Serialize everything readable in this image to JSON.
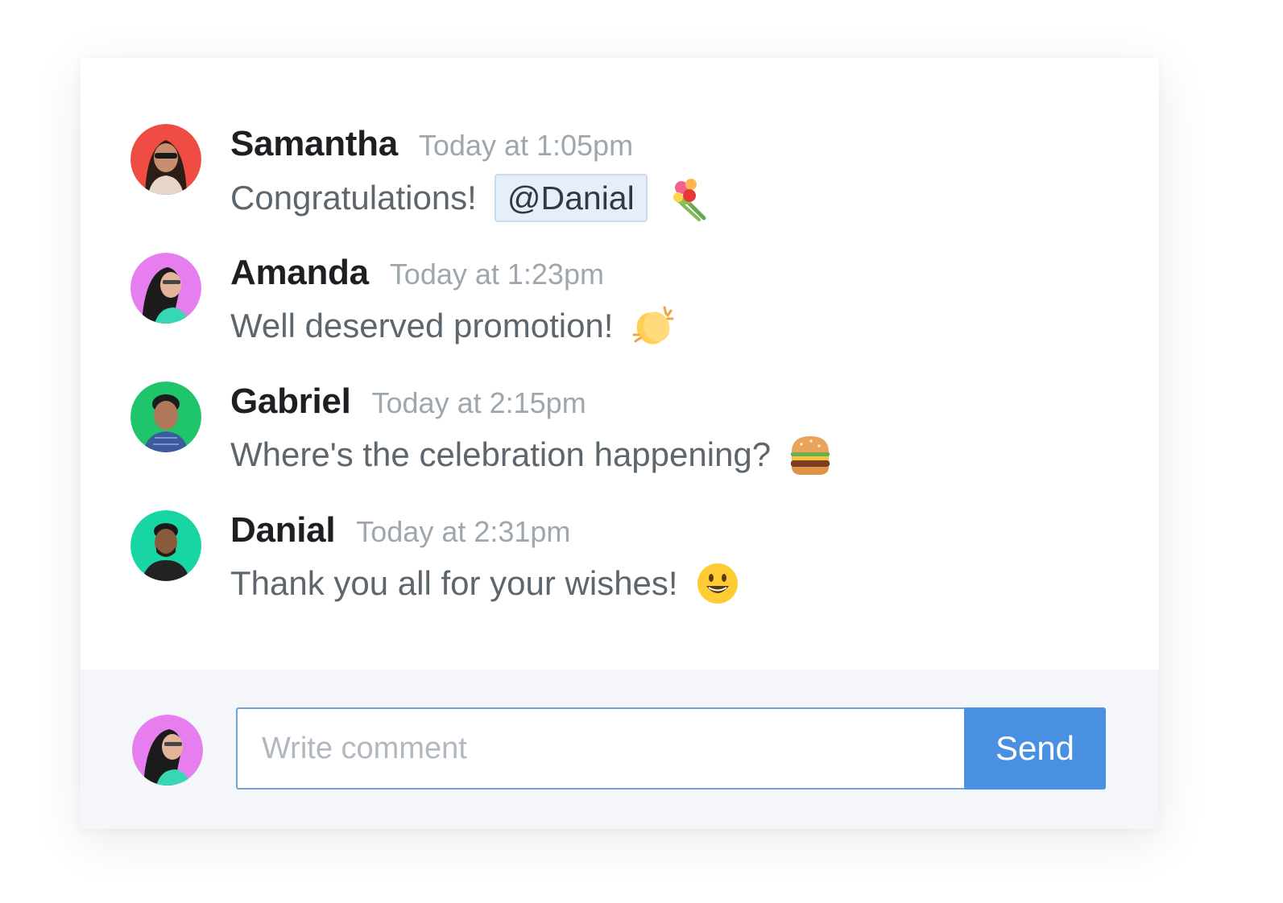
{
  "messages": [
    {
      "author": "Samantha",
      "time": "Today at 1:05pm",
      "text": "Congratulations!",
      "mention": "@Danial",
      "emoji": "bouquet-emoji",
      "avatar_bg": "#ef4c43"
    },
    {
      "author": "Amanda",
      "time": "Today at 1:23pm",
      "text": "Well deserved promotion!",
      "emoji": "clapping-hands-emoji",
      "avatar_bg": "#e67ef0"
    },
    {
      "author": "Gabriel",
      "time": "Today at 2:15pm",
      "text": "Where's the celebration happening?",
      "emoji": "hamburger-emoji",
      "avatar_bg": "#1fc56b"
    },
    {
      "author": "Danial",
      "time": "Today at 2:31pm",
      "text": "Thank you all for your wishes!",
      "emoji": "smiley-emoji",
      "avatar_bg": "#18d6a3"
    }
  ],
  "composer": {
    "placeholder": "Write comment",
    "value": "",
    "send_label": "Send",
    "avatar_bg": "#e67ef0"
  },
  "colors": {
    "accent": "#4a90e2",
    "mention_bg": "#e6eff9",
    "composer_bg": "#f4f6f9"
  }
}
